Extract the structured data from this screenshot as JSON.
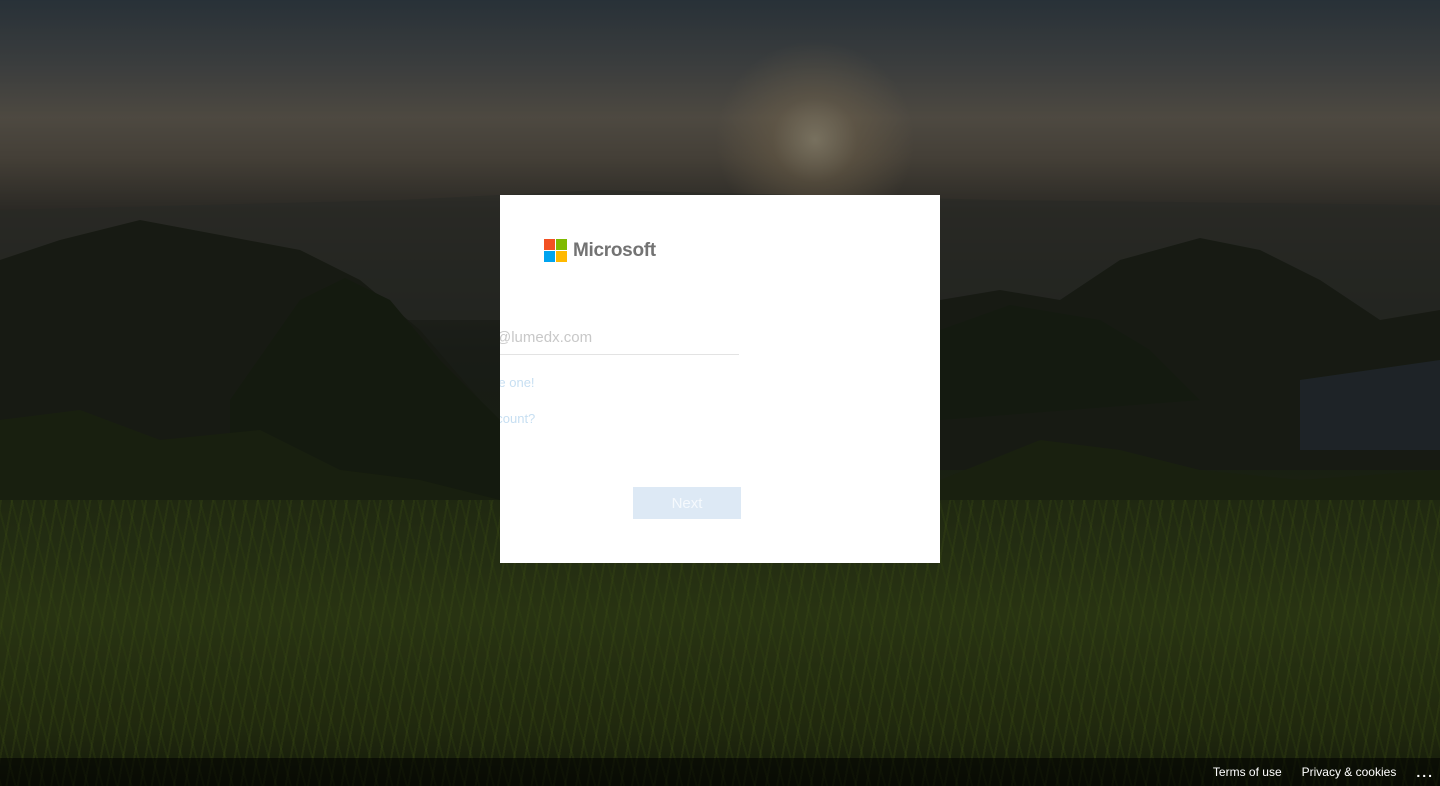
{
  "logo": {
    "text": "Microsoft",
    "colors": [
      "#f25022",
      "#7fba00",
      "#00a4ef",
      "#ffb900"
    ]
  },
  "signin": {
    "email_value": "@lumedx.com",
    "create_account_link": "No account? Create one!",
    "cant_access_link": "Can't access your account?",
    "next_label": "Next"
  },
  "footer": {
    "terms_label": "Terms of use",
    "privacy_label": "Privacy & cookies",
    "more_label": "..."
  }
}
